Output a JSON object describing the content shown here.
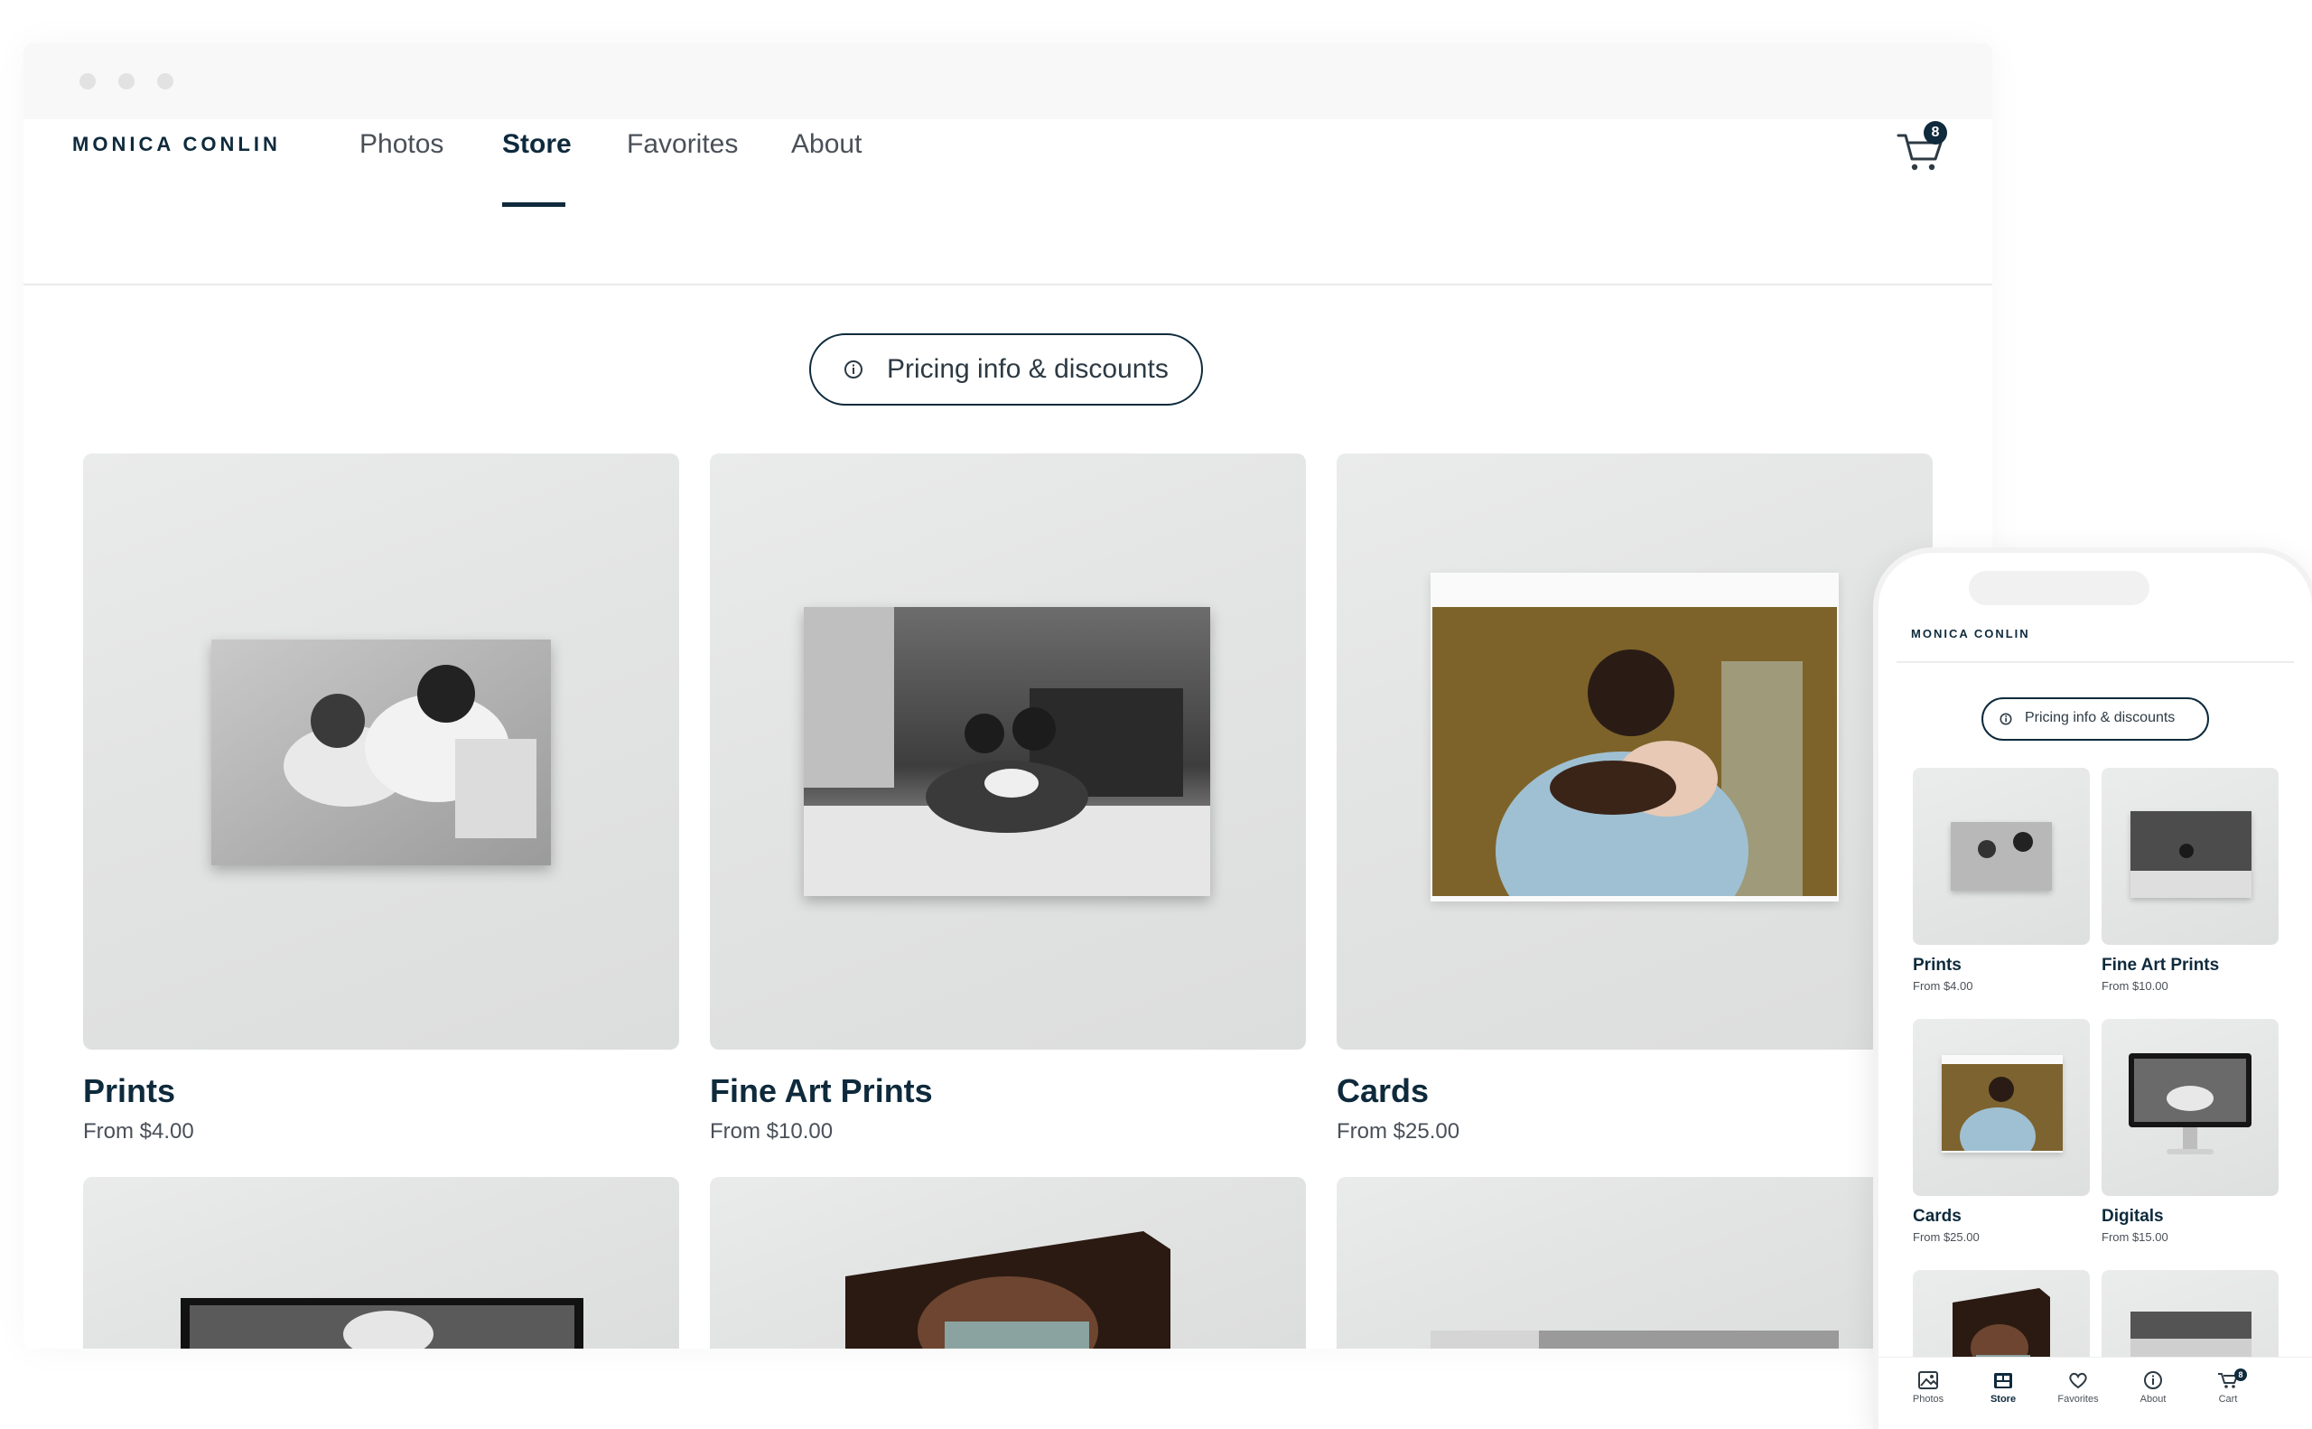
{
  "brand": {
    "name": "MONICA CONLIN",
    "accent": "#0e2a3c"
  },
  "nav": {
    "items": [
      {
        "label": "Photos"
      },
      {
        "label": "Store",
        "active": true
      },
      {
        "label": "Favorites"
      },
      {
        "label": "About"
      }
    ],
    "cart_count": "8"
  },
  "pricing_button": {
    "label": "Pricing info & discounts",
    "icon": "info-circle-icon"
  },
  "products": [
    {
      "title": "Prints",
      "price": "From $4.00"
    },
    {
      "title": "Fine Art Prints",
      "price": "From $10.00"
    },
    {
      "title": "Cards",
      "price": "From $25.00"
    }
  ],
  "mobile": {
    "logo": "MONICA CONLIN",
    "pricing_label": "Pricing info & discounts",
    "products": [
      {
        "title": "Prints",
        "price": "From $4.00"
      },
      {
        "title": "Fine Art Prints",
        "price": "From $10.00"
      },
      {
        "title": "Cards",
        "price": "From $25.00"
      },
      {
        "title": "Digitals",
        "price": "From $15.00"
      }
    ],
    "tabs": [
      {
        "label": "Photos",
        "icon": "photo-icon"
      },
      {
        "label": "Store",
        "icon": "store-icon",
        "active": true
      },
      {
        "label": "Favorites",
        "icon": "heart-icon"
      },
      {
        "label": "About",
        "icon": "info-circle-icon"
      },
      {
        "label": "Cart",
        "icon": "cart-icon"
      }
    ],
    "cart_count": "8"
  }
}
